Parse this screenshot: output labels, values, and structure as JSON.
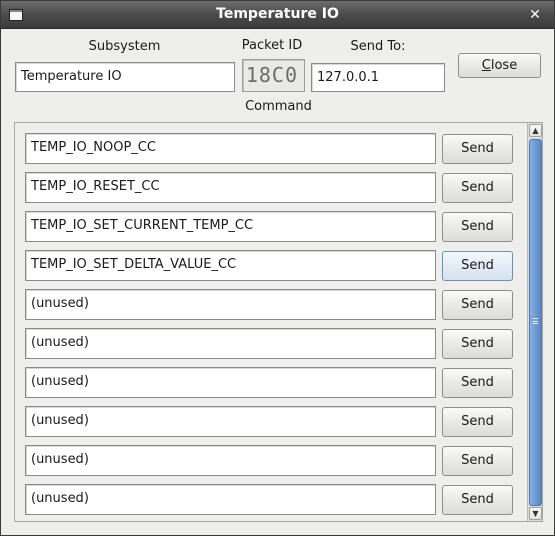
{
  "window": {
    "title": "Temperature IO",
    "close_glyph": "✕"
  },
  "header": {
    "subsystem_label": "Subsystem",
    "subsystem_value": "Temperature IO",
    "packet_id_label": "Packet ID",
    "packet_id_value": "18C0",
    "send_to_label": "Send To:",
    "send_to_value": "127.0.0.1",
    "close_button_prefix": "",
    "close_button_mnemonic": "C",
    "close_button_rest": "lose",
    "command_label": "Command"
  },
  "commands": [
    {
      "name": "TEMP_IO_NOOP_CC",
      "send_label": "Send"
    },
    {
      "name": "TEMP_IO_RESET_CC",
      "send_label": "Send"
    },
    {
      "name": "TEMP_IO_SET_CURRENT_TEMP_CC",
      "send_label": "Send"
    },
    {
      "name": "TEMP_IO_SET_DELTA_VALUE_CC",
      "send_label": "Send"
    },
    {
      "name": "(unused)",
      "send_label": "Send"
    },
    {
      "name": "(unused)",
      "send_label": "Send"
    },
    {
      "name": "(unused)",
      "send_label": "Send"
    },
    {
      "name": "(unused)",
      "send_label": "Send"
    },
    {
      "name": "(unused)",
      "send_label": "Send"
    },
    {
      "name": "(unused)",
      "send_label": "Send"
    }
  ],
  "scrollbar": {
    "up_glyph": "▲",
    "down_glyph": "▼"
  },
  "colors": {
    "titlebar": "#4b4b4b",
    "accent_scrollbar": "#6f9ad2",
    "window_bg": "#eeeeec"
  }
}
